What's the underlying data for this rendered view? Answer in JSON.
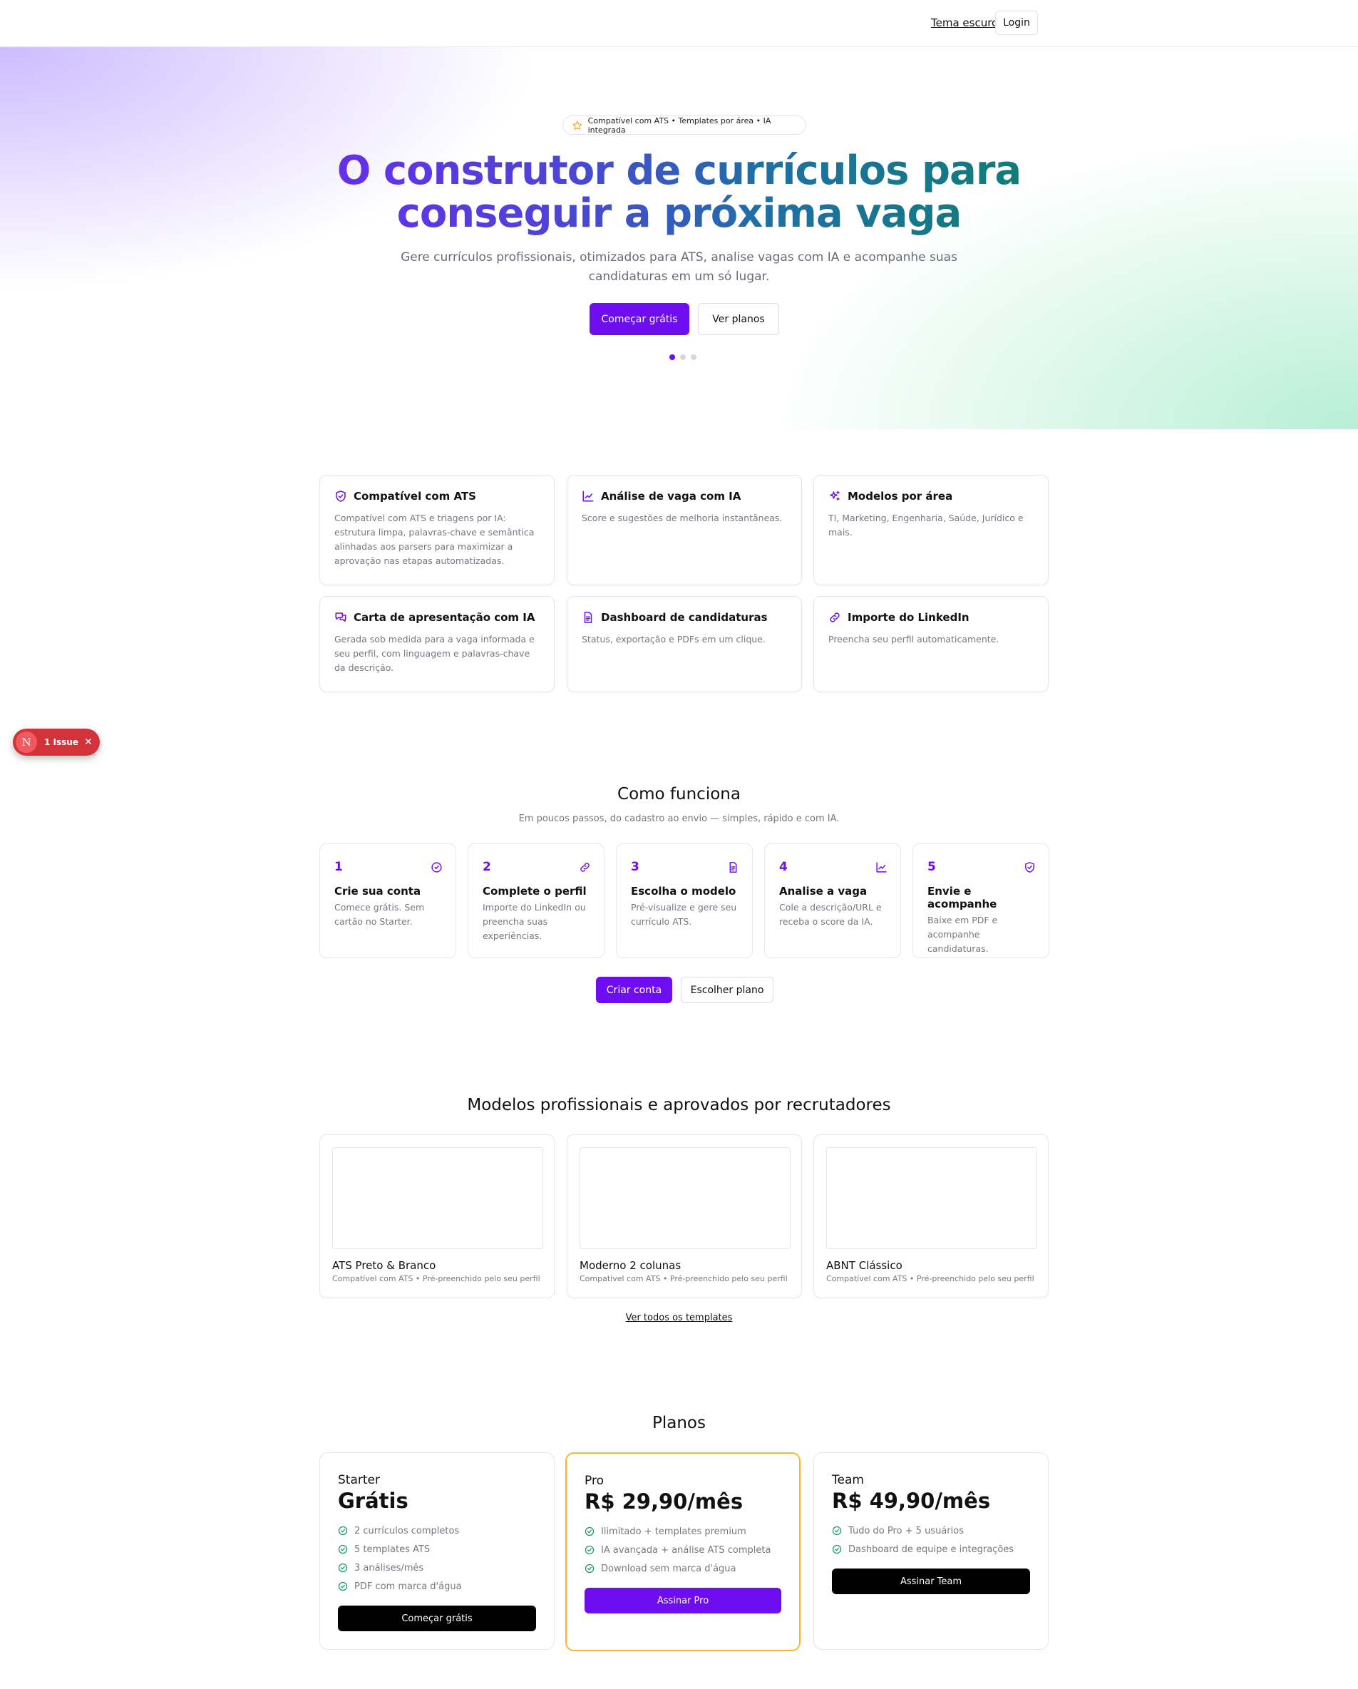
{
  "header": {
    "theme_toggle": "Tema escuro",
    "login": "Login"
  },
  "hero": {
    "pill": "Compatível com ATS • Templates por área • IA integrada",
    "title_line1": "O construtor de currículos para",
    "title_line2": "conseguir a próxima vaga",
    "subtitle_line1": "Gere currículos profissionais, otimizados para ATS, analise vagas com IA e acompanhe suas",
    "subtitle_line2": "candidaturas em um só lugar.",
    "cta_primary": "Começar grátis",
    "cta_secondary": "Ver planos",
    "carousel_active": 1,
    "carousel_total": 3
  },
  "features": [
    {
      "icon": "shield-check-icon",
      "title": "Compatível com ATS",
      "desc": "Compatível com ATS e triagens por IA: estrutura limpa, palavras-chave e semântica alinhadas aos parsers para maximizar a aprovação nas etapas automatizadas."
    },
    {
      "icon": "line-chart-icon",
      "title": "Análise de vaga com IA",
      "desc": "Score e sugestões de melhoria instantâneas."
    },
    {
      "icon": "sparkles-icon",
      "title": "Modelos por área",
      "desc": "TI, Marketing, Engenharia, Saúde, Jurídico e mais."
    },
    {
      "icon": "chat-bubbles-icon",
      "title": "Carta de apresentação com IA",
      "desc": "Gerada sob medida para a vaga informada e seu perfil, com linguagem e palavras-chave da descrição."
    },
    {
      "icon": "document-icon",
      "title": "Dashboard de candidaturas",
      "desc": "Status, exportação e PDFs em um clique."
    },
    {
      "icon": "link-icon",
      "title": "Importe do LinkedIn",
      "desc": "Preencha seu perfil automaticamente."
    }
  ],
  "issue_badge": {
    "letter": "N",
    "label": "1 Issue"
  },
  "how": {
    "title": "Como funciona",
    "subtitle": "Em poucos passos, do cadastro ao envio — simples, rápido e com IA.",
    "steps": [
      {
        "num": "1",
        "icon": "check-circle-icon",
        "title": "Crie sua conta",
        "desc": "Comece grátis. Sem cartão no Starter."
      },
      {
        "num": "2",
        "icon": "link-icon",
        "title": "Complete o perfil",
        "desc": "Importe do LinkedIn ou preencha suas experiências."
      },
      {
        "num": "3",
        "icon": "document-icon",
        "title": "Escolha o modelo",
        "desc": "Pré-visualize e gere seu currículo ATS."
      },
      {
        "num": "4",
        "icon": "line-chart-icon",
        "title": "Analise a vaga",
        "desc": "Cole a descrição/URL e receba o score da IA."
      },
      {
        "num": "5",
        "icon": "shield-check-icon",
        "title": "Envie e acompanhe",
        "desc": "Baixe em PDF e acompanhe candidaturas."
      }
    ],
    "cta_primary": "Criar conta",
    "cta_secondary": "Escolher plano"
  },
  "templates": {
    "title": "Modelos profissionais e aprovados por recrutadores",
    "items": [
      {
        "name": "ATS Preto & Branco",
        "meta": "Compatível com ATS • Pré-preenchido pelo seu perfil"
      },
      {
        "name": "Moderno 2 colunas",
        "meta": "Compatível com ATS • Pré-preenchido pelo seu perfil"
      },
      {
        "name": "ABNT Clássico",
        "meta": "Compatível com ATS • Pré-preenchido pelo seu perfil"
      }
    ],
    "see_all": "Ver todos os templates"
  },
  "plans": {
    "title": "Planos",
    "items": [
      {
        "name": "Starter",
        "price": "Grátis",
        "features": [
          "2 currículos completos",
          "5 templates ATS",
          "3 análises/mês",
          "PDF com marca d'água"
        ],
        "cta": "Começar grátis",
        "highlight": false
      },
      {
        "name": "Pro",
        "price": "R$ 29,90/mês",
        "features": [
          "Ilimitado + templates premium",
          "IA avançada + análise ATS completa",
          "Download sem marca d'água"
        ],
        "cta": "Assinar Pro",
        "highlight": true
      },
      {
        "name": "Team",
        "price": "R$ 49,90/mês",
        "features": [
          "Tudo do Pro + 5 usuários",
          "Dashboard de equipe e integrações"
        ],
        "cta": "Assinar Team",
        "highlight": false
      }
    ]
  },
  "colors": {
    "accent": "#6d0df0",
    "featured_border": "#f5b82e",
    "check": "#1a9a6c",
    "issue_badge": "#d4323a"
  }
}
